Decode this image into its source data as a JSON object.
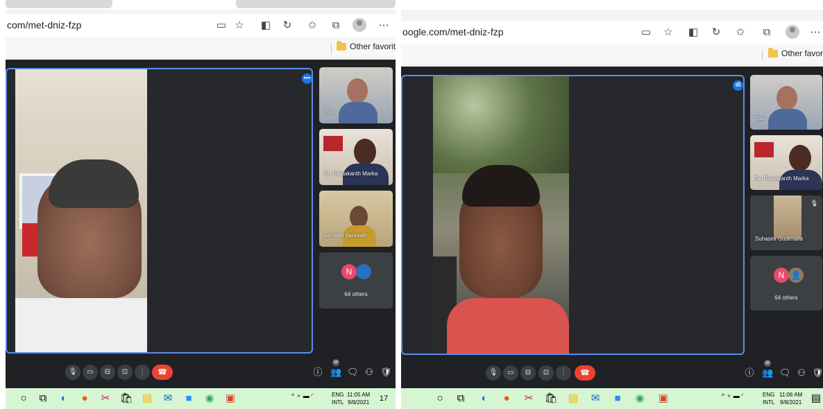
{
  "left": {
    "url": "com/met-dniz-fzp",
    "favorites_label": "Other favorites",
    "tiles": [
      {
        "name": "You"
      },
      {
        "name": "Dr. Rajnakanth Marka"
      },
      {
        "name": "parvathi daravath"
      }
    ],
    "others_label": "64 others",
    "others_initial": "N",
    "people_count": "68",
    "tray": {
      "lang1": "ENG",
      "lang2": "INTL",
      "time": "11:05 AM",
      "date": "9/8/2021",
      "notif": "17"
    }
  },
  "right": {
    "url": "oogle.com/met-dniz-fzp",
    "favorites_label": "Other favorite",
    "tiles": [
      {
        "name": "You"
      },
      {
        "name": "Dr. Rajnakanth Marka"
      },
      {
        "name": "Suhasini Gudimalla"
      }
    ],
    "others_label": "64 others",
    "others_initial": "N",
    "people_count": "68",
    "tray": {
      "lang1": "ENG",
      "lang2": "INTL",
      "time": "11:06 AM",
      "date": "9/8/2021"
    }
  },
  "icons": {
    "mic": "🎙",
    "camera": "▭",
    "captions": "⊟",
    "present": "⊡",
    "more": "⋮",
    "hangup": "☎",
    "info": "ⓘ",
    "people": "👥",
    "chat": "🗨",
    "activities": "⚇",
    "lock": "🛡"
  },
  "colors": {
    "accent": "#5b8def",
    "end_call": "#ea4335",
    "meet_bg": "#202124",
    "taskbar": "#d6f5d3",
    "avatar_n": "#e84b6b"
  }
}
